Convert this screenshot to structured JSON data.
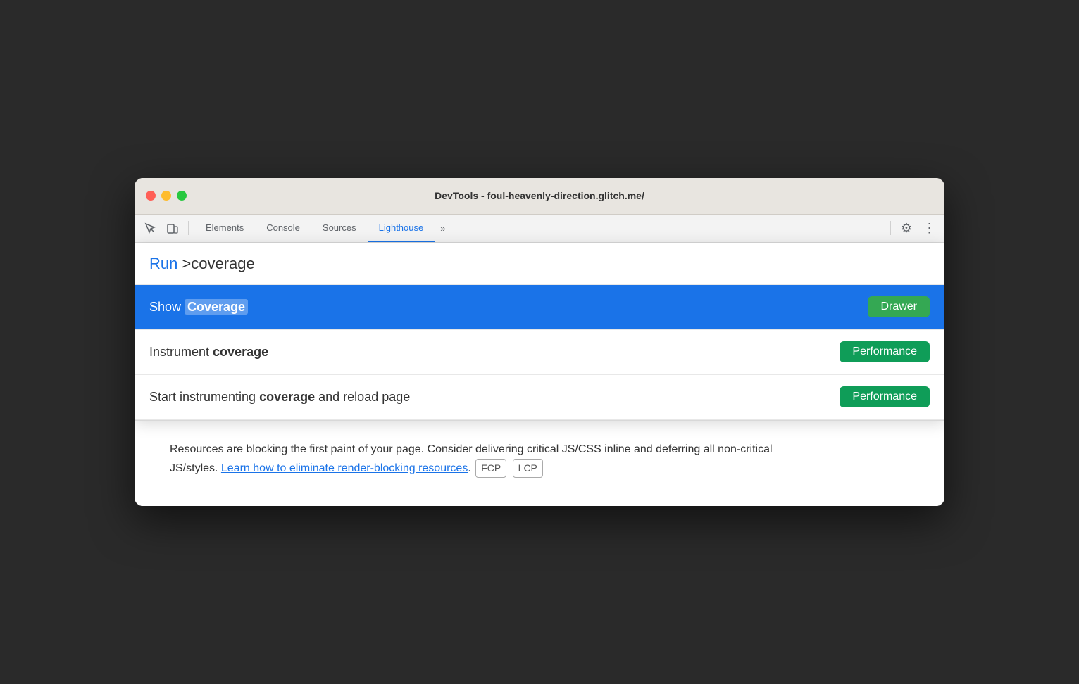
{
  "window": {
    "title": "DevTools - foul-heavenly-direction.glitch.me/"
  },
  "toolbar": {
    "tabs": [
      {
        "id": "elements",
        "label": "Elements",
        "active": false
      },
      {
        "id": "console",
        "label": "Console",
        "active": false
      },
      {
        "id": "sources",
        "label": "Sources",
        "active": false
      },
      {
        "id": "lighthouse",
        "label": "Lighthouse",
        "active": true
      }
    ],
    "more_label": "»",
    "settings_label": "⚙",
    "menu_label": "⋮"
  },
  "command_palette": {
    "run_label": "Run",
    "input_value": ">coverage",
    "suggestions": [
      {
        "id": "show-coverage",
        "prefix": "Show ",
        "highlight": "Coverage",
        "suffix": "",
        "badge": "Drawer",
        "badge_type": "drawer",
        "highlighted": true
      },
      {
        "id": "instrument-coverage",
        "prefix": "Instrument ",
        "highlight": "coverage",
        "suffix": "",
        "badge": "Performance",
        "badge_type": "performance",
        "highlighted": false
      },
      {
        "id": "start-instrumenting",
        "prefix": "Start instrumenting ",
        "highlight": "coverage",
        "suffix": " and reload page",
        "badge": "Performance",
        "badge_type": "performance",
        "highlighted": false
      }
    ]
  },
  "main_content": {
    "description_part1": "Resources are blocking the first paint of your page. Consider delivering critical JS/CSS inline and deferring all non-critical JS/styles. ",
    "description_link": "Learn how to eliminate render-blocking resources",
    "description_part2": ". ",
    "tags": [
      "FCP",
      "LCP"
    ]
  },
  "colors": {
    "highlight_bg": "#1a73e8",
    "drawer_badge": "#34a853",
    "performance_badge": "#0f9d58",
    "link_color": "#1a73e8"
  }
}
